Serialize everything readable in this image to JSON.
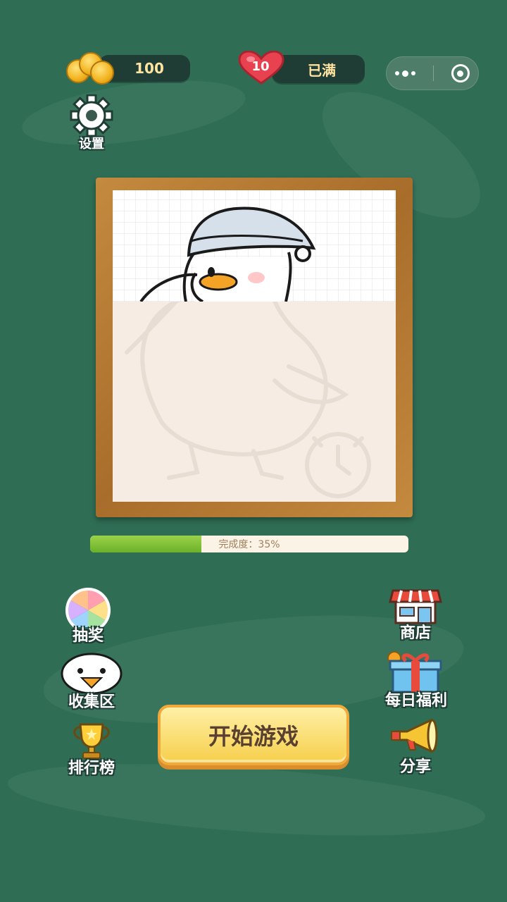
{
  "status": {
    "coins": "100",
    "hearts": "10",
    "hearts_status": "已满"
  },
  "capsule": {
    "more_icon": "more-dots-icon",
    "close_icon": "target-circle-icon"
  },
  "settings": {
    "label": "设置",
    "icon": "gear-icon"
  },
  "puzzle": {
    "progress_fraction": 0.35,
    "progress_text": "完成度：35%"
  },
  "left_menu": [
    {
      "label": "抽奖",
      "icon": "lucky-wheel-icon"
    },
    {
      "label": "收集区",
      "icon": "duck-icon"
    },
    {
      "label": "排行榜",
      "icon": "trophy-icon"
    }
  ],
  "right_menu": [
    {
      "label": "商店",
      "icon": "store-icon"
    },
    {
      "label": "每日福利",
      "icon": "gift-box-icon"
    },
    {
      "label": "分享",
      "icon": "megaphone-icon"
    }
  ],
  "start_button": {
    "label": "开始游戏"
  },
  "colors": {
    "background": "#2f6e55",
    "pill": "#1f3d35",
    "progress": "#7cc23a",
    "frame": "#b07632",
    "button": "#f6cf4b"
  }
}
